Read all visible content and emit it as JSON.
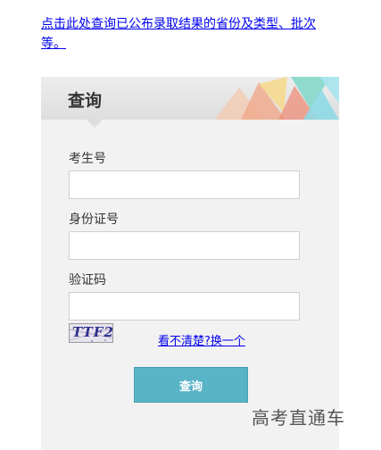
{
  "top_link": {
    "text": "点击此处查询已公布录取结果的省份及类型、批次等。"
  },
  "panel": {
    "title": "查询",
    "fields": [
      {
        "label": "考生号",
        "value": "",
        "placeholder": ""
      },
      {
        "label": "身份证号",
        "value": "",
        "placeholder": ""
      },
      {
        "label": "验证码",
        "value": "",
        "placeholder": ""
      }
    ],
    "captcha_text": "TTF2",
    "refresh_link": "看不清楚?换一个",
    "submit_label": "查询"
  },
  "watermark": "高考直通车",
  "colors": {
    "accent": "#5ab4c8",
    "link": "#0000ee",
    "panel_bg": "#f2f2f2"
  }
}
